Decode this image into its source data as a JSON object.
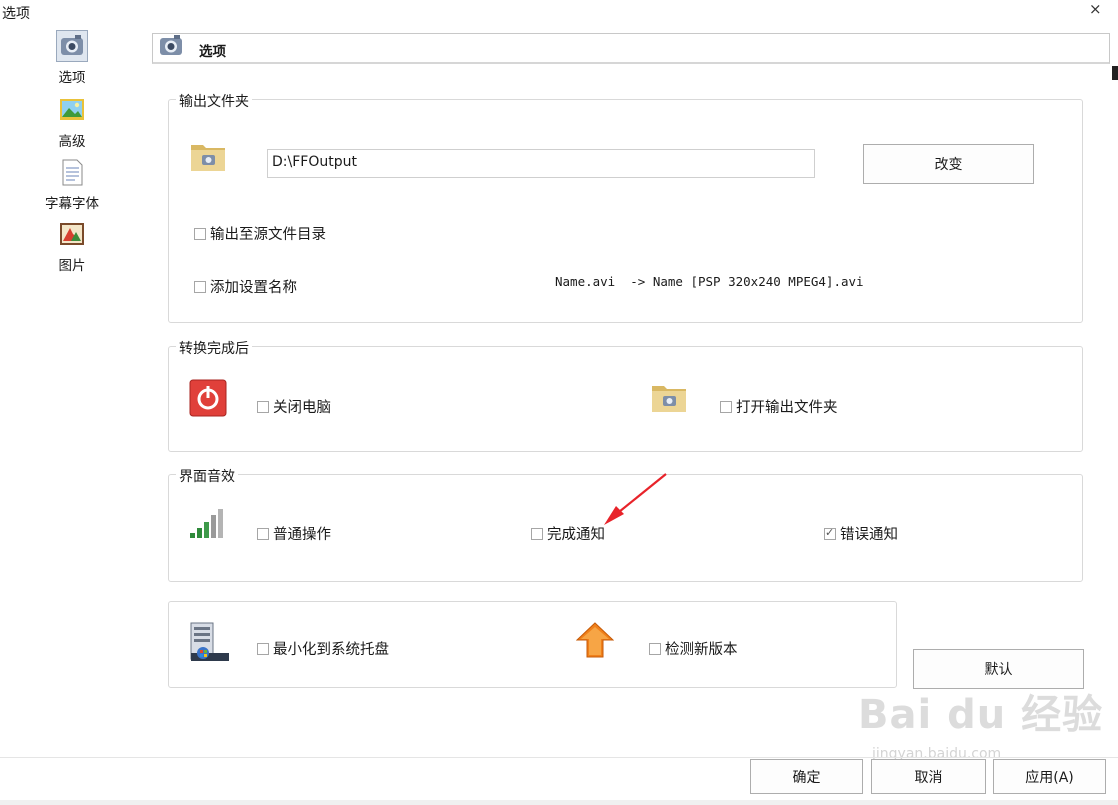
{
  "window": {
    "title": "选项",
    "close_glyph": "×"
  },
  "sidebar": {
    "items": [
      {
        "label": "选项",
        "icon": "options-camera-icon",
        "selected": true
      },
      {
        "label": "高级",
        "icon": "landscape-picture-icon",
        "selected": false
      },
      {
        "label": "字幕字体",
        "icon": "document-icon",
        "selected": false
      },
      {
        "label": "图片",
        "icon": "picture-book-icon",
        "selected": false
      }
    ]
  },
  "header": {
    "title": "选项"
  },
  "output_folder": {
    "legend": "输出文件夹",
    "path_value": "D:\\FFOutput",
    "change_button": "改变",
    "output_to_source_label": "输出至源文件目录",
    "add_setting_name_label": "添加设置名称",
    "example_text": "Name.avi  -> Name [PSP 320x240 MPEG4].avi"
  },
  "after_conversion": {
    "legend": "转换完成后",
    "shutdown_label": "关闭电脑",
    "open_folder_label": "打开输出文件夹"
  },
  "ui_sound": {
    "legend": "界面音效",
    "normal_label": "普通操作",
    "done_label": "完成通知",
    "error_label": "错误通知",
    "error_checked": true
  },
  "misc": {
    "minimize_tray_label": "最小化到系统托盘",
    "check_update_label": "检测新版本"
  },
  "buttons": {
    "default": "默认",
    "ok": "确定",
    "cancel": "取消",
    "apply": "应用(A)"
  },
  "watermark": {
    "logo": "Bai du 经验",
    "url": "jingyan.baidu.com"
  },
  "colors": {
    "accent_red": "#e0403a",
    "folder": "#e8cf8a",
    "arrow_orange": "#f0801a",
    "annotation_arrow": "#e8232a"
  }
}
